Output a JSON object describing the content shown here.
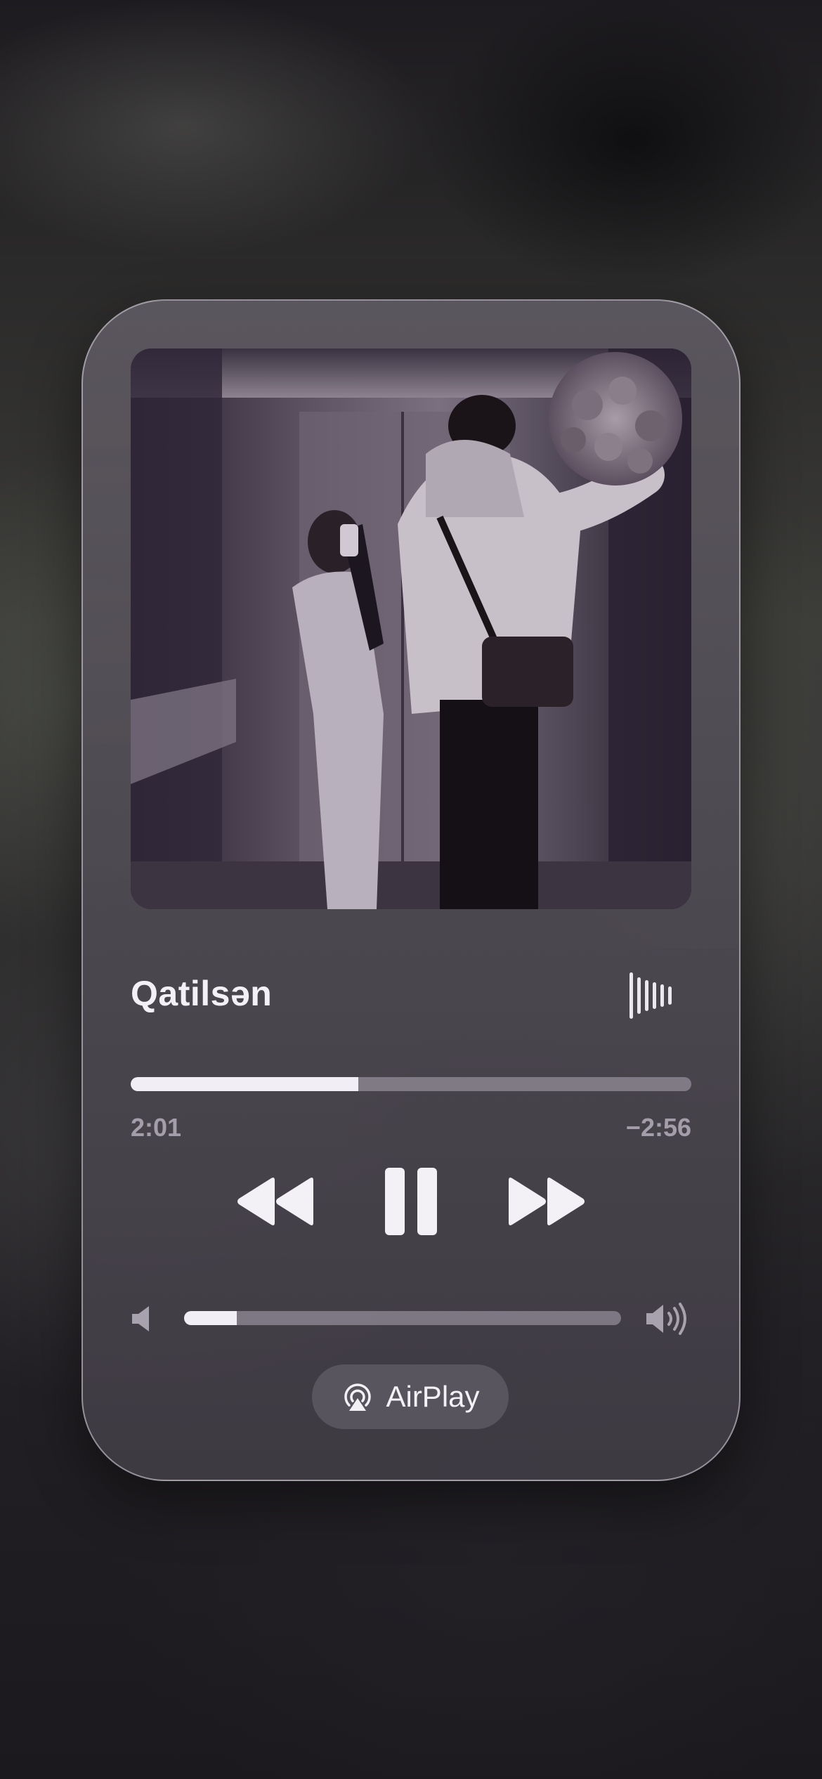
{
  "now_playing": {
    "title": "Qatilsən",
    "elapsed": "2:01",
    "remaining": "−2:56",
    "progress": 0.406,
    "volume": 0.12
  },
  "controls": {
    "rewind_icon": "backward-icon",
    "pause_icon": "pause-icon",
    "forward_icon": "forward-icon",
    "waveform_icon": "waveform-icon",
    "volume_low_icon": "speaker-low-icon",
    "volume_high_icon": "speaker-high-icon"
  },
  "airplay": {
    "label": "AirPlay",
    "icon": "airplay-icon"
  },
  "colors": {
    "accent": "#f2eef5",
    "track": "#aea8b6",
    "card": "#5c5862"
  }
}
